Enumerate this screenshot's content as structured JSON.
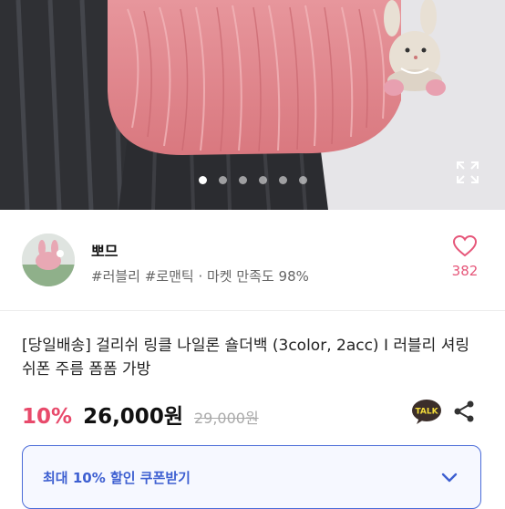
{
  "seller": {
    "name": "뽀므",
    "meta": "#러블리 #로맨틱 · 마켓 만족도 98%",
    "likes": "382"
  },
  "product": {
    "title": "[당일배송] 걸리쉬 링클 나일론 숄더백 (3color, 2acc) I 러블리 셔링 쉬폰 주름 폼폼 가방",
    "discount": "10%",
    "price": "26,000원",
    "original_price": "29,000원"
  },
  "coupon": {
    "label": "최대 10% 할인 쿠폰받기"
  },
  "carousel": {
    "active_index": 0,
    "count": 6
  },
  "icons": {
    "talk": "TALK"
  },
  "colors": {
    "accent_pink": "#e84a6b",
    "coupon_blue": "#3d5fd1"
  }
}
